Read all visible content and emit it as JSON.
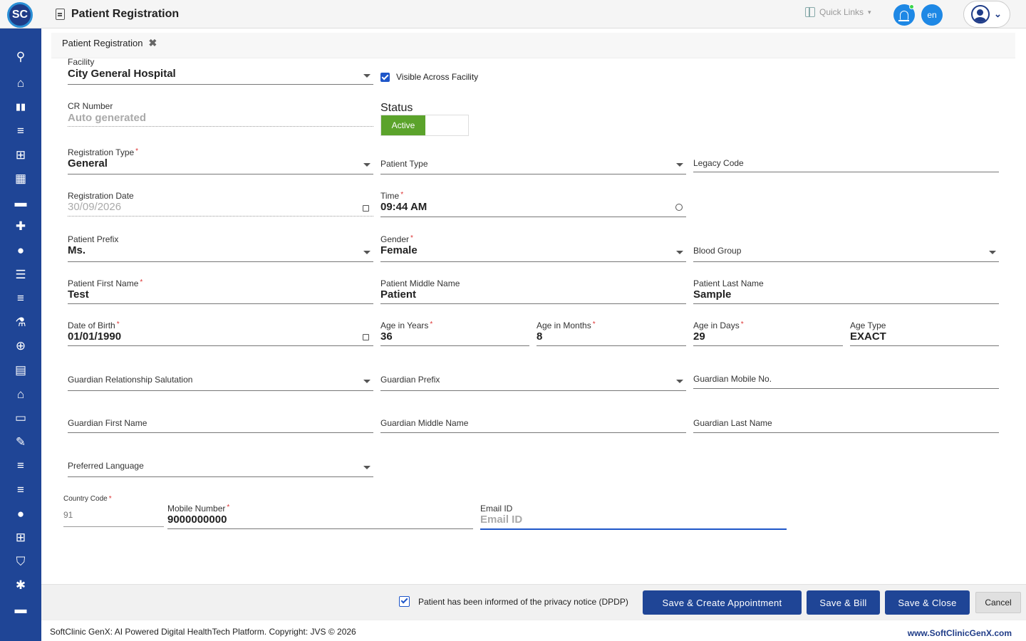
{
  "header": {
    "logo_text": "SC",
    "title": "Patient Registration",
    "quick_links": "Quick Links",
    "language": "en"
  },
  "sidebar": {
    "items": [
      {
        "icon": "search-icon",
        "glyph": "⌕"
      },
      {
        "icon": "home-icon",
        "glyph": "⌂"
      },
      {
        "icon": "bar-chart-icon",
        "glyph": "▮"
      },
      {
        "icon": "menu-icon",
        "glyph": "≡"
      },
      {
        "icon": "medical-bag-icon",
        "glyph": "⊞"
      },
      {
        "icon": "calendar-icon",
        "glyph": "▦"
      },
      {
        "icon": "bed-icon",
        "glyph": "⛼"
      },
      {
        "icon": "hospital-plus-icon",
        "glyph": "✚"
      },
      {
        "icon": "person-icon",
        "glyph": "●"
      },
      {
        "icon": "list-icon",
        "glyph": "☰"
      },
      {
        "icon": "menu-icon",
        "glyph": "≡"
      },
      {
        "icon": "lab-icon",
        "glyph": "⚗"
      },
      {
        "icon": "pharmacy-icon",
        "glyph": "⊕"
      },
      {
        "icon": "book-icon",
        "glyph": "▤"
      },
      {
        "icon": "store-icon",
        "glyph": "⌂"
      },
      {
        "icon": "devices-icon",
        "glyph": "▭"
      },
      {
        "icon": "wrench-icon",
        "glyph": "✎"
      },
      {
        "icon": "menu-icon",
        "glyph": "≡"
      },
      {
        "icon": "menu-icon",
        "glyph": "≡"
      },
      {
        "icon": "drop-icon",
        "glyph": "●"
      },
      {
        "icon": "add-box-icon",
        "glyph": "⊞"
      },
      {
        "icon": "shield-icon",
        "glyph": "⛉"
      },
      {
        "icon": "hub-icon",
        "glyph": "✱"
      },
      {
        "icon": "folder-icon",
        "glyph": "▬"
      }
    ]
  },
  "tab": {
    "label": "Patient Registration",
    "close": "✖"
  },
  "form": {
    "facility": {
      "label": "Facility",
      "value": "City General Hospital"
    },
    "visible_across": "Visible Across Facility",
    "cr_number": {
      "label": "CR Number",
      "value": "Auto generated"
    },
    "status": {
      "label": "Status",
      "value": "Active"
    },
    "registration_type": {
      "label": "Registration Type",
      "value": "General"
    },
    "patient_type": {
      "label": "Patient Type"
    },
    "legacy_code": {
      "label": "Legacy Code"
    },
    "registration_date": {
      "label": "Registration Date",
      "value": "30/09/2026"
    },
    "time": {
      "label": "Time",
      "value": "09:44 AM"
    },
    "patient_prefix": {
      "label": "Patient Prefix",
      "value": "Ms."
    },
    "gender": {
      "label": "Gender",
      "value": "Female"
    },
    "blood_group": {
      "label": "Blood Group"
    },
    "first_name": {
      "label": "Patient First Name",
      "value": "Test"
    },
    "middle_name": {
      "label": "Patient Middle Name",
      "value": "Patient"
    },
    "last_name": {
      "label": "Patient Last Name",
      "value": "Sample"
    },
    "dob": {
      "label": "Date of Birth",
      "value": "01/01/1990"
    },
    "age_years": {
      "label": "Age in Years",
      "value": "36"
    },
    "age_months": {
      "label": "Age in Months",
      "value": "8"
    },
    "age_days": {
      "label": "Age in Days",
      "value": "29"
    },
    "age_type": {
      "label": "Age Type",
      "value": "EXACT"
    },
    "guardian_salutation": {
      "label": "Guardian Relationship Salutation"
    },
    "guardian_prefix": {
      "label": "Guardian Prefix"
    },
    "guardian_mobile": {
      "label": "Guardian Mobile No."
    },
    "guardian_first": {
      "label": "Guardian First Name"
    },
    "guardian_middle": {
      "label": "Guardian Middle Name"
    },
    "guardian_last": {
      "label": "Guardian Last Name"
    },
    "preferred_language": {
      "label": "Preferred Language"
    },
    "country_code": {
      "label": "Country Code",
      "value": "91"
    },
    "mobile": {
      "label": "Mobile Number",
      "value": "9000000000"
    },
    "email": {
      "label": "Email ID",
      "placeholder": "Email ID"
    }
  },
  "actions": {
    "privacy_notice": "Patient has been informed of the privacy notice (DPDP)",
    "save_appointment": "Save & Create Appointment",
    "save_bill": "Save & Bill",
    "save_close": "Save & Close",
    "cancel": "Cancel"
  },
  "footer": {
    "copyright": "SoftClinic GenX: AI Powered Digital HealthTech Platform. Copyright: JVS © 2026",
    "website": "www.SoftClinicGenX.com"
  },
  "colors": {
    "brand": "#1f4596",
    "accent": "#1e88e5",
    "active": "#5ba32b"
  }
}
